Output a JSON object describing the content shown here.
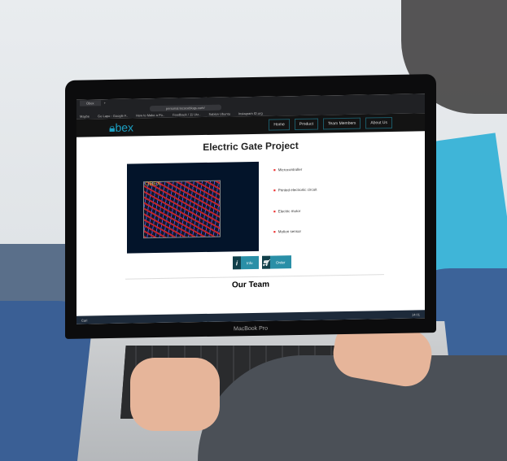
{
  "browser": {
    "tab": "Obex",
    "url": "personal.tecoceblogs.com/",
    "bookmarks": [
      "Maybe",
      "Go Lapo - Google F..",
      "How to Make a Po..",
      "Feedback / 11 Utz..",
      "Sablon Ubuntu",
      "Instagram ID.org"
    ]
  },
  "site": {
    "logo": "bex",
    "nav": [
      "Home",
      "Product",
      "Team Members",
      "About Us"
    ],
    "title": "Electric Gate Project",
    "pcb_label": "OBEX",
    "features": [
      "Microcontroller",
      "Printed electronic circuit",
      "Electric motor",
      "Motion sensor"
    ],
    "info_button": "Info",
    "order_button": "Order",
    "section": "Our Team"
  },
  "taskbar": {
    "search": "Cari",
    "time": "14:01"
  },
  "laptop": {
    "brand": "MacBook Pro"
  }
}
